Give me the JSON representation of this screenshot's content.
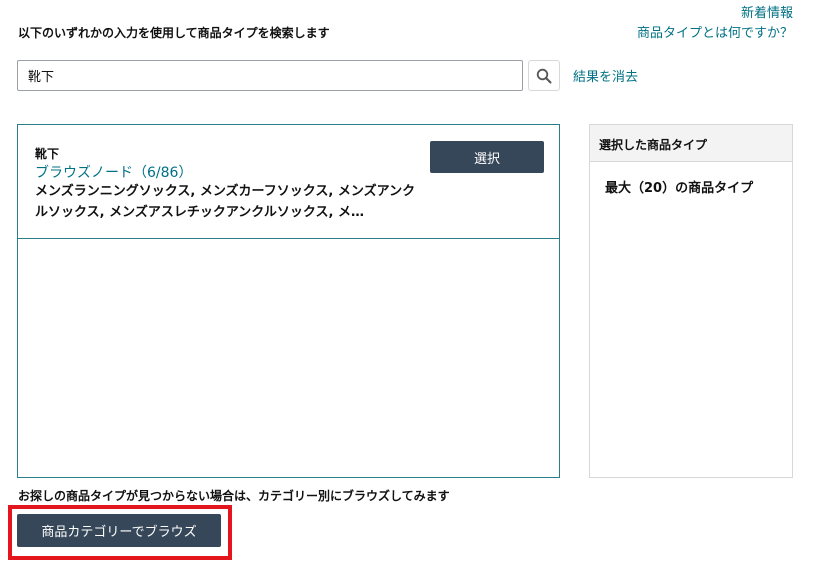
{
  "header": {
    "instruction": "以下のいずれかの入力を使用して商品タイプを検索します",
    "whats_new_link": "新着情報",
    "what_is_product_type_link": "商品タイプとは何ですか？"
  },
  "search": {
    "value": "靴下",
    "icon": "search-icon",
    "clear_label": "結果を消去"
  },
  "results": [
    {
      "keyword": "靴下",
      "node_label": "ブラウズノード（6/86）",
      "description": "メンズランニングソックス, メンズカーフソックス, メンズアンクルソックス, メンズアスレチックアンクルソックス, メ…",
      "select_label": "選択"
    }
  ],
  "selected_panel": {
    "title": "選択した商品タイプ",
    "max_text": "最大（20）の商品タイプ"
  },
  "footer": {
    "not_found_text": "お探しの商品タイプが見つからない場合は、カテゴリー別にブラウズしてみます",
    "browse_label": "商品カテゴリーでブラウズ"
  },
  "colors": {
    "link": "#007185",
    "button_dark": "#37475a",
    "result_border": "#2a7e85",
    "highlight": "#e4161d"
  }
}
